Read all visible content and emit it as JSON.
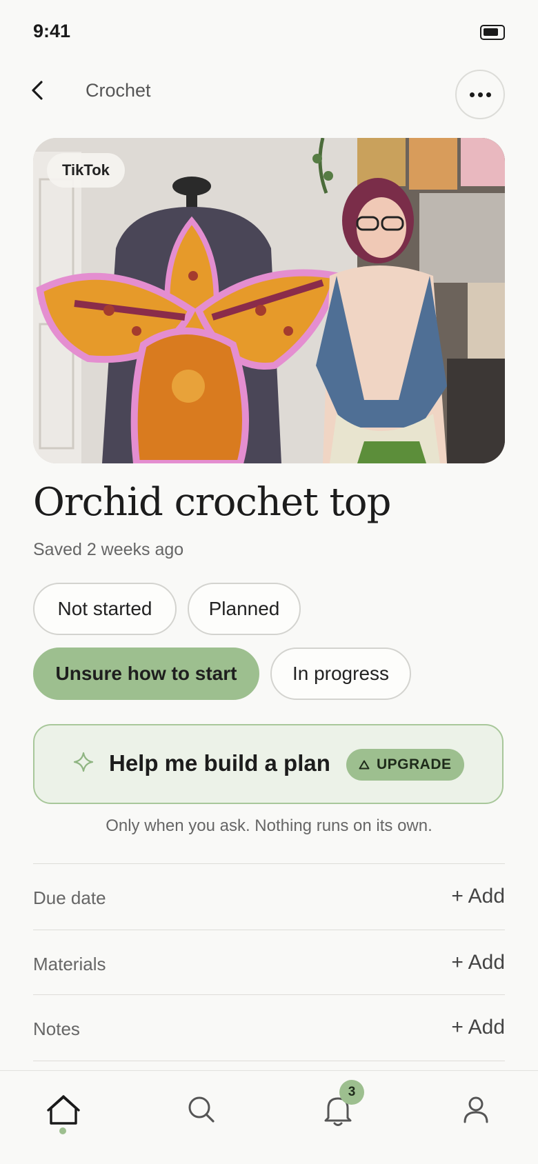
{
  "status_bar": {
    "time": "9:41",
    "battery_icon": "battery-icon"
  },
  "nav": {
    "back_icon": "chevron-left-icon",
    "title": "Crochet",
    "more_icon": "ellipsis-icon"
  },
  "hero": {
    "source": "TikTok",
    "image_description": "photo"
  },
  "project": {
    "title": "Orchid crochet top",
    "saved": "Saved 2 weeks ago"
  },
  "status_chips": [
    {
      "label": "Not started",
      "selected": false
    },
    {
      "label": "Planned",
      "selected": false
    },
    {
      "label": "Unsure how to start",
      "selected": true
    },
    {
      "label": "In progress",
      "selected": false
    }
  ],
  "plan": {
    "icon": "sparkle-icon",
    "label": "Help me build a plan",
    "badge": "UPGRADE",
    "badge_icon": "triangle-up-icon",
    "note": "Only when you ask. Nothing runs on its own."
  },
  "fields": [
    {
      "label": "Due date",
      "action": "+ Add"
    },
    {
      "label": "Materials",
      "action": "+ Add"
    },
    {
      "label": "Notes",
      "action": "+ Add"
    }
  ],
  "tab_bar": {
    "tabs": [
      "home-icon",
      "search-icon",
      "bell-icon",
      "profile-icon"
    ],
    "active": "home-icon",
    "notification_count": "3"
  },
  "colors": {
    "accent": "#9dbf8f",
    "background": "#f9f9f7",
    "card_bg": "#ecf2e8"
  }
}
